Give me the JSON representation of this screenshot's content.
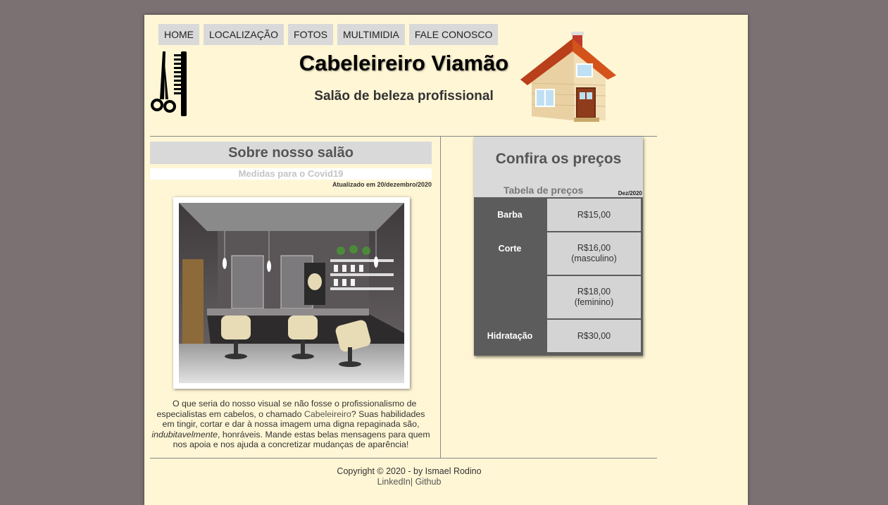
{
  "nav": {
    "items": [
      {
        "label": "HOME"
      },
      {
        "label": "LOCALIZAÇÃO"
      },
      {
        "label": "FOTOS"
      },
      {
        "label": "MULTIMIDIA"
      },
      {
        "label": "FALE CONOSCO"
      }
    ]
  },
  "header": {
    "title": "Cabeleireiro Viamão",
    "subtitle": "Salão de beleza profissional",
    "logo_icon": "scissors-comb-icon",
    "house_icon": "house-icon"
  },
  "about": {
    "title": "Sobre nosso salão",
    "covid_link": "Medidas para o Covid19",
    "updated": "Atualizado em 20/dezembro/2020",
    "text_part1": "O que seria do nosso visual se não fosse o profissionalismo de especialistas em cabelos, o chamado ",
    "text_link": "Cabeleireiro",
    "text_part2": "? Suas habilidades em tingir, cortar e dar à nossa imagem uma digna repaginada são, ",
    "text_emph": "indubitavelmente",
    "text_part3": ", honráveis. Mande estas belas mensagens para quem nos apoia e nos ajuda a concretizar mudanças de aparência!"
  },
  "prices": {
    "title": "Confira os preços",
    "table_label": "Tabela de preços",
    "date": "Dez/2020",
    "rows": [
      {
        "service": "Barba",
        "price": "R$15,00",
        "note": ""
      },
      {
        "service": "Corte",
        "price": "R$16,00",
        "note": "(masculino)"
      },
      {
        "service": "",
        "price": "R$18,00",
        "note": "(feminino)"
      },
      {
        "service": "Hidratação",
        "price": "R$30,00",
        "note": ""
      }
    ]
  },
  "footer": {
    "copyright": "Copyright © 2020 - by Ismael Rodino",
    "linkedin": "LinkedIn",
    "separator": "| ",
    "github": "Github"
  },
  "colors": {
    "background": "#7b7173",
    "page": "#fff6d5",
    "panel": "#d9d9d9",
    "table_dark": "#5c5c5c"
  }
}
